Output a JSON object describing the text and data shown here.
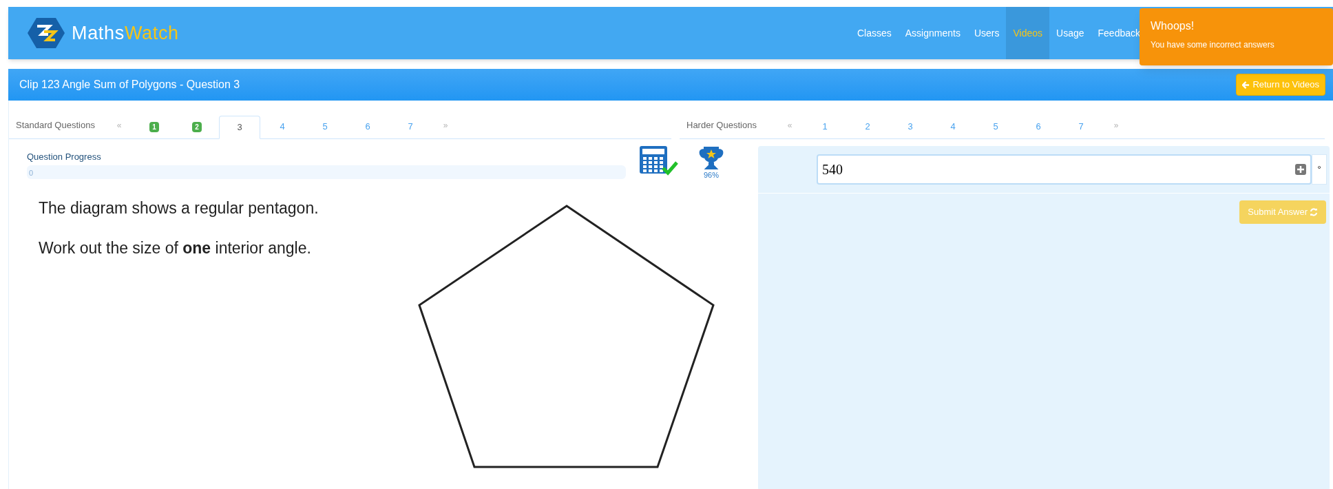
{
  "header": {
    "logo": {
      "part_1": "Maths",
      "part_2": "Watch"
    },
    "nav": [
      {
        "label": "Classes",
        "selected": false
      },
      {
        "label": "Assignments",
        "selected": false
      },
      {
        "label": "Users",
        "selected": false
      },
      {
        "label": "Videos",
        "selected": true
      },
      {
        "label": "Usage",
        "selected": false
      },
      {
        "label": "Feedback",
        "selected": false
      }
    ]
  },
  "toast": {
    "title": "Whoops!",
    "message": "You have some incorrect answers"
  },
  "title_bar": {
    "title": "Clip 123 Angle Sum of Polygons - Question 3",
    "button": "Return to Videos"
  },
  "standard_questions": {
    "label": "Standard Questions",
    "prev": "«",
    "next": "»",
    "tabs": [
      {
        "label": "1",
        "selected": false,
        "answered": true
      },
      {
        "label": "2",
        "selected": false,
        "answered": true
      },
      {
        "label": "3",
        "selected": true,
        "answered": false
      },
      {
        "label": "4",
        "selected": false,
        "answered": false
      },
      {
        "label": "5",
        "selected": false,
        "answered": false
      },
      {
        "label": "6",
        "selected": false,
        "answered": false
      },
      {
        "label": "7",
        "selected": false,
        "answered": false
      }
    ]
  },
  "harder_questions": {
    "label": "Harder Questions",
    "prev": "«",
    "next": "»",
    "tabs": [
      {
        "label": "1",
        "selected": false,
        "answered": false
      },
      {
        "label": "2",
        "selected": false,
        "answered": false
      },
      {
        "label": "3",
        "selected": false,
        "answered": false
      },
      {
        "label": "4",
        "selected": false,
        "answered": false
      },
      {
        "label": "5",
        "selected": false,
        "answered": false
      },
      {
        "label": "6",
        "selected": false,
        "answered": false
      },
      {
        "label": "7",
        "selected": false,
        "answered": false
      }
    ]
  },
  "progress": {
    "label": "Question Progress",
    "level": 0,
    "reading": "0"
  },
  "calculator_allowed": true,
  "score": "96%",
  "question": [
    "The diagram shows a regular pentagon.",
    "Work out the size of **one** interior angle."
  ],
  "answer": {
    "value": "540",
    "unit": "°",
    "button": "Submit Answer"
  }
}
